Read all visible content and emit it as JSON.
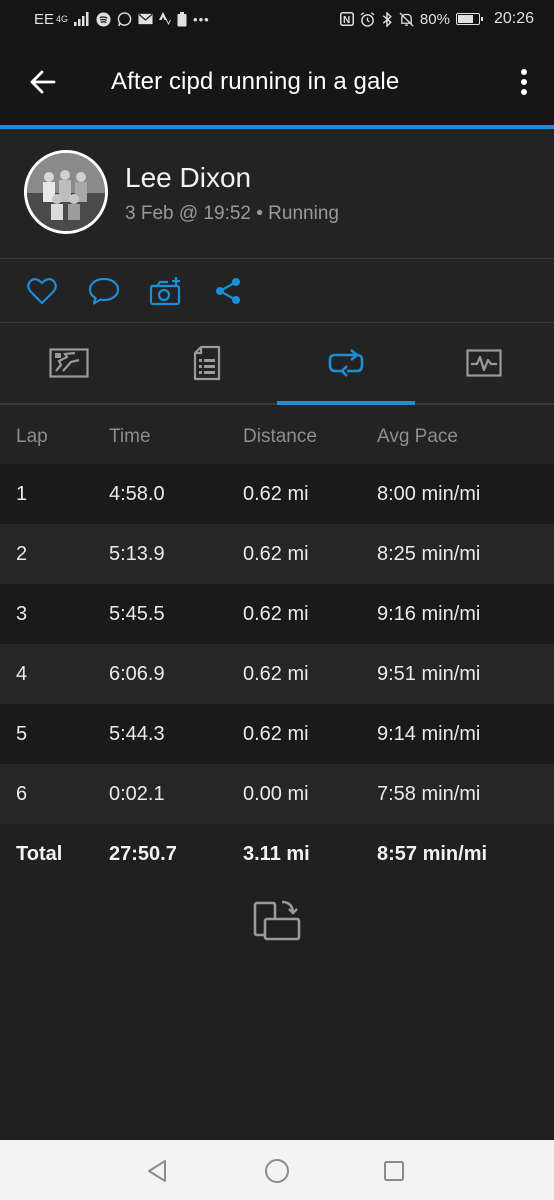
{
  "status_bar": {
    "carrier": "EE",
    "network": "4G",
    "left_icons": [
      "signal-icon",
      "spotify-icon",
      "whatsapp-icon",
      "mail-icon",
      "strava-icon",
      "battery-saver-icon",
      "more-dots-icon"
    ],
    "right_icons": [
      "nfc-icon",
      "alarm-icon",
      "bluetooth-icon",
      "mute-icon"
    ],
    "battery": "80%",
    "battery_level": 0.8,
    "time": "20:26"
  },
  "app_bar": {
    "title": "After cipd running in a gale",
    "back_icon": "arrow-left-icon",
    "menu_icon": "more-vertical-icon"
  },
  "colors": {
    "accent": "#1a8fd6",
    "background": "#202020",
    "appbar": "#161616"
  },
  "activity": {
    "user_name": "Lee Dixon",
    "meta": "3 Feb @ 19:52 • Running"
  },
  "actions": [
    "heart-icon",
    "comment-icon",
    "add-photo-icon",
    "share-icon"
  ],
  "tabs": [
    {
      "icon": "map-tab-icon",
      "active": false
    },
    {
      "icon": "details-tab-icon",
      "active": false
    },
    {
      "icon": "laps-tab-icon",
      "active": true
    },
    {
      "icon": "charts-tab-icon",
      "active": false
    }
  ],
  "laps": {
    "headers": {
      "lap": "Lap",
      "time": "Time",
      "distance": "Distance",
      "pace": "Avg Pace"
    },
    "rows": [
      {
        "lap": "1",
        "time": "4:58.0",
        "distance": "0.62 mi",
        "pace": "8:00 min/mi"
      },
      {
        "lap": "2",
        "time": "5:13.9",
        "distance": "0.62 mi",
        "pace": "8:25 min/mi"
      },
      {
        "lap": "3",
        "time": "5:45.5",
        "distance": "0.62 mi",
        "pace": "9:16 min/mi"
      },
      {
        "lap": "4",
        "time": "6:06.9",
        "distance": "0.62 mi",
        "pace": "9:51 min/mi"
      },
      {
        "lap": "5",
        "time": "5:44.3",
        "distance": "0.62 mi",
        "pace": "9:14 min/mi"
      },
      {
        "lap": "6",
        "time": "0:02.1",
        "distance": "0.00 mi",
        "pace": "7:58 min/mi"
      }
    ],
    "total": {
      "label": "Total",
      "time": "27:50.7",
      "distance": "3.11 mi",
      "pace": "8:57 min/mi"
    }
  },
  "rotate_icon": "rotate-screen-icon",
  "nav_bar": [
    "back-triangle-icon",
    "home-circle-icon",
    "recents-square-icon"
  ]
}
